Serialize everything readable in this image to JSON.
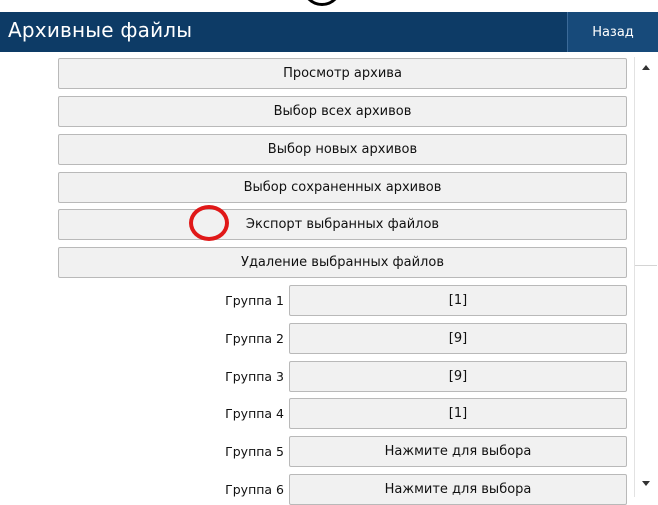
{
  "header": {
    "title": "Архивные файлы",
    "back_label": "Назад"
  },
  "actions": [
    {
      "label": "Просмотр архива"
    },
    {
      "label": "Выбор всех архивов"
    },
    {
      "label": "Выбор новых архивов"
    },
    {
      "label": "Выбор сохраненных архивов"
    },
    {
      "label": "Экспорт выбранных файлов"
    },
    {
      "label": "Удаление выбранных файлов"
    }
  ],
  "groups": [
    {
      "label": "Группа 1",
      "value": "[1]"
    },
    {
      "label": "Группа 2",
      "value": "[9]"
    },
    {
      "label": "Группа 3",
      "value": "[9]"
    },
    {
      "label": "Группа 4",
      "value": "[1]"
    },
    {
      "label": "Группа 5",
      "value": "Нажмите для выбора"
    },
    {
      "label": "Группа 6",
      "value": "Нажмите для выбора"
    }
  ],
  "colors": {
    "header_bg": "#0d3b66",
    "button_bg": "#f1f1f1",
    "highlight": "#e01818"
  }
}
